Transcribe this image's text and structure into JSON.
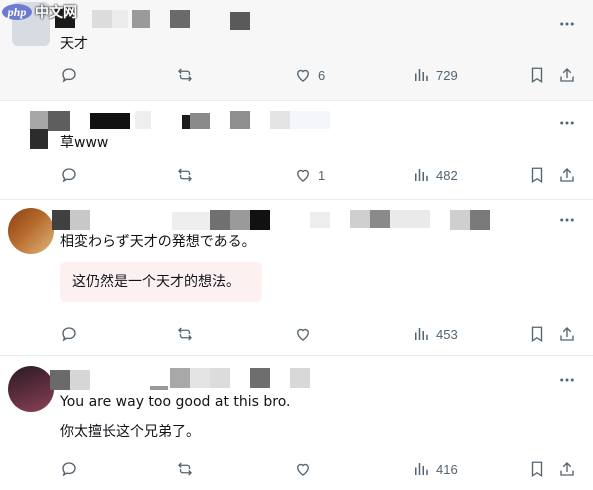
{
  "watermark": {
    "brand": "php",
    "site": "中文网"
  },
  "posts": [
    {
      "text": "天才",
      "stats": {
        "likes": "6",
        "views": "729"
      }
    },
    {
      "text": "草www",
      "stats": {
        "likes": "1",
        "views": "482"
      }
    },
    {
      "text": "相変わらず天才の発想である。",
      "translation": "这仍然是一个天才的想法。",
      "stats": {
        "likes": "",
        "views": "453"
      }
    },
    {
      "text": "You are way too good at this bro.",
      "text2": "你太擅长这个兄弟了。",
      "stats": {
        "likes": "",
        "views": "416"
      }
    }
  ],
  "icons": {
    "reply": "reply-icon",
    "retweet": "retweet-icon",
    "like": "heart-icon",
    "views": "views-icon",
    "bookmark": "bookmark-icon",
    "share": "share-icon",
    "more": "more-icon"
  },
  "colors": {
    "icon": "#536471",
    "text": "#0f1419",
    "translation_bg": "#fcf0f1",
    "divider": "#e6ecf0"
  }
}
